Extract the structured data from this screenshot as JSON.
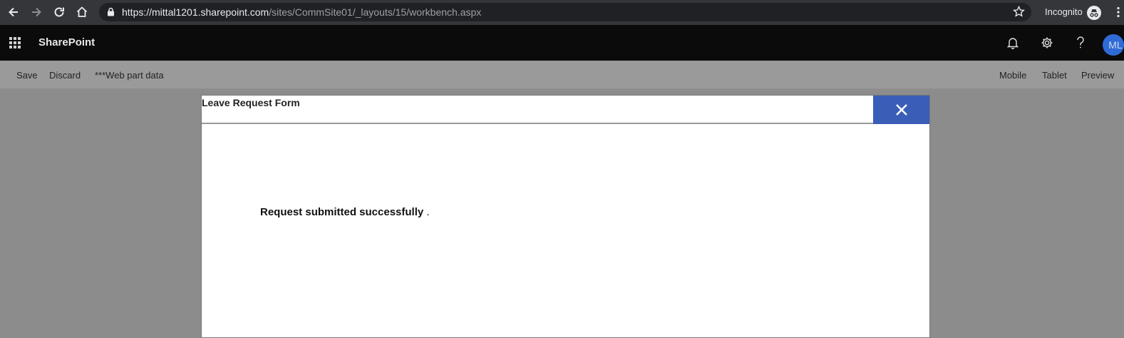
{
  "browser": {
    "url_host": "https://mittal1201.sharepoint.com",
    "url_path": "/sites/CommSite01/_layouts/15/workbench.aspx",
    "mode_label": "Incognito"
  },
  "suite": {
    "brand": "SharePoint",
    "avatar_initials": "ML"
  },
  "command_bar": {
    "left": [
      "Save",
      "Discard",
      "***Web part data"
    ],
    "right": [
      "Mobile",
      "Tablet",
      "Preview"
    ]
  },
  "dialog": {
    "title": "Leave Request Form",
    "message": "Request submitted successfully",
    "message_suffix": ".",
    "close_color": "#3a5eb7"
  }
}
